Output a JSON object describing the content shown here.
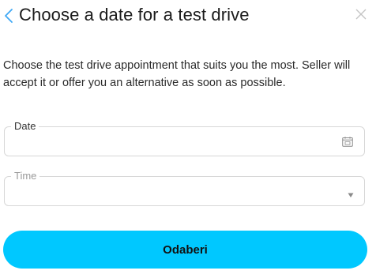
{
  "header": {
    "title": "Choose a date for a test drive",
    "back_icon": "chevron-left-icon",
    "close_icon": "close-icon"
  },
  "description": "Choose the test drive appointment that suits you the most. Seller will accept it or offer you an alternative as soon as possible.",
  "date_field": {
    "label": "Date",
    "value": "",
    "icon": "calendar-icon"
  },
  "time_field": {
    "label": "Time",
    "value": "",
    "icon": "caret-down-icon"
  },
  "submit": {
    "label": "Odaberi"
  },
  "colors": {
    "accent": "#00c8ff",
    "icon": "#3fa9f5",
    "border": "#d7d7d7"
  }
}
